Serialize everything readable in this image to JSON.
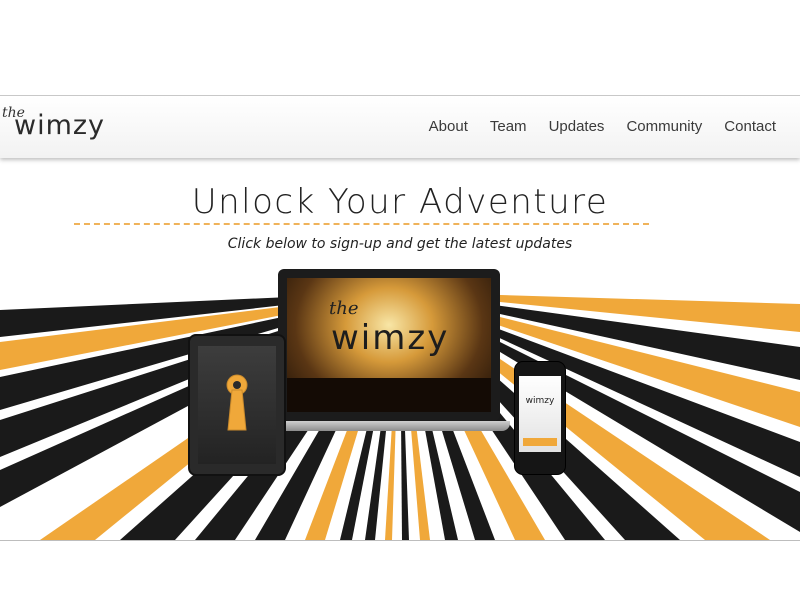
{
  "brand": {
    "logo_the": "the",
    "logo_word": "wimzy"
  },
  "nav": {
    "items": [
      {
        "label": "About"
      },
      {
        "label": "Team"
      },
      {
        "label": "Updates"
      },
      {
        "label": "Community"
      },
      {
        "label": "Contact"
      }
    ]
  },
  "hero": {
    "headline": "Unlock Your Adventure",
    "subhead": "Click below to sign-up and get the latest updates"
  },
  "devices": {
    "laptop_screen_the": "the",
    "laptop_screen_word": "wimzy",
    "phone_logo": "wimzy"
  },
  "colors": {
    "accent": "#f0a83a",
    "dark": "#1a1a1a",
    "background": "#ffffff"
  }
}
